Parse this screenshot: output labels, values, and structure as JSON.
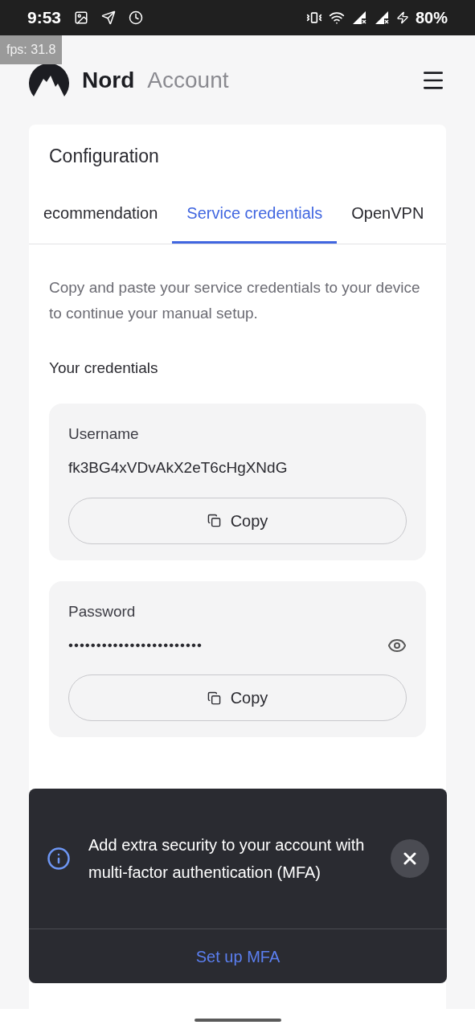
{
  "status_bar": {
    "time": "9:53",
    "battery": "80%"
  },
  "debug_overlay": {
    "text": "fps: 31.8"
  },
  "header": {
    "brand": "Nord",
    "product": "Account"
  },
  "card": {
    "title": "Configuration",
    "tabs": [
      {
        "label": "ecommendation",
        "selected": false
      },
      {
        "label": "Service credentials",
        "selected": true
      },
      {
        "label": "OpenVPN",
        "selected": false
      }
    ],
    "description": "Copy and paste your service credentials to your device to continue your manual setup.",
    "section_title": "Your credentials",
    "credentials": [
      {
        "kind": "plain",
        "label": "Username",
        "value": "fk3BG4xVDvAkX2eT6cHgXNdG",
        "button": "Copy"
      },
      {
        "kind": "secret",
        "label": "Password",
        "value": "••••••••••••••••••••••••",
        "button": "Copy"
      }
    ]
  },
  "toast": {
    "message": "Add extra security to your account with multi-factor authentication (MFA)",
    "action": "Set up MFA"
  }
}
